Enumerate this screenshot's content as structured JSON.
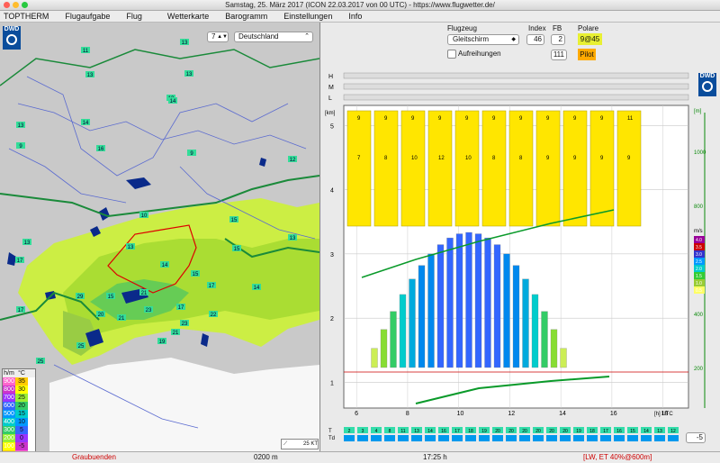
{
  "window": {
    "title": "Samstag, 25. März 2017 (ICON 22.03.2017 von 00 UTC) - https://www.flugwetter.de/"
  },
  "menu": [
    "TOPTHERM",
    "Flugaufgabe",
    "Flug",
    "Wetterkarte",
    "Barogramm",
    "Einstellungen",
    "Info"
  ],
  "map": {
    "hour": "7",
    "region": "Deutschland",
    "logo": "DWD",
    "wind_label": "25 KT",
    "legend_headers": [
      "h/m",
      "°C"
    ],
    "legend_alt": [
      "900",
      "800",
      "700",
      "600",
      "500",
      "400",
      "300",
      "200",
      "100",
      "50"
    ],
    "legend_temp": [
      "35",
      "30",
      "25",
      "20",
      "15",
      "10",
      "5",
      "0",
      "-5",
      "-10"
    ],
    "legend_colors": [
      "#ff66cc",
      "#cc33cc",
      "#9933ff",
      "#3366ff",
      "#0099ff",
      "#00cccc",
      "#33cc66",
      "#99ee33",
      "#ffff00",
      "#ffcc00"
    ],
    "values": [
      "11",
      "13",
      "13",
      "13",
      "13",
      "13",
      "12",
      "14",
      "16",
      "14",
      "9",
      "9",
      "10",
      "13",
      "14",
      "15",
      "15",
      "13",
      "15",
      "17",
      "13",
      "14",
      "17",
      "15",
      "21",
      "29",
      "20",
      "21",
      "23",
      "19",
      "21",
      "22",
      "23",
      "25",
      "25",
      "17",
      "17"
    ]
  },
  "controls": {
    "flugzeug_label": "Flugzeug",
    "flugzeug_value": "Gleitschirm",
    "index_label": "Index",
    "index_value": "46",
    "fb_label": "FB",
    "fb_value": "2",
    "polare_label": "Polare",
    "polare_value": "9@45",
    "aufreihungen_label": "Aufreihungen",
    "pilot_value": "111",
    "pilot_label": "Pilot"
  },
  "chart_data": {
    "type": "table",
    "y_left_unit": "[km]",
    "y_left_ticks": [
      "1",
      "2",
      "3",
      "4",
      "5"
    ],
    "y_right_ticks": [
      "200",
      "400",
      "600",
      "800",
      "1000"
    ],
    "y_right_unit": "[m]",
    "x_ticks": [
      "6",
      "8",
      "10",
      "12",
      "14",
      "16",
      "18"
    ],
    "x_unit": "[h] UTC",
    "cloud_rows": [
      "H",
      "M",
      "L"
    ],
    "row_labels": [
      "T",
      "Td"
    ],
    "bottom_values": [
      "2",
      "3",
      "4",
      "8",
      "11",
      "13",
      "14",
      "16",
      "17",
      "18",
      "19",
      "20",
      "20",
      "20",
      "20",
      "20",
      "20",
      "19",
      "18",
      "17",
      "16",
      "15",
      "14",
      "13",
      "12"
    ],
    "cumulus_top_values": [
      "9",
      "9",
      "9",
      "9",
      "9",
      "9",
      "9",
      "9",
      "9",
      "9",
      "11"
    ],
    "cumulus_mid_values": [
      "7",
      "8",
      "10",
      "12",
      "10",
      "8",
      "8",
      "9",
      "9",
      "9",
      "9"
    ],
    "climb_legend": [
      "4.0",
      "3.5",
      "3.0",
      "2.5",
      "2.0",
      "1.5",
      "1.0",
      "0.5"
    ],
    "climb_unit": "m/s",
    "scale_value": "-5"
  },
  "status": {
    "left": "Graubuenden",
    "altitude": "0200 m",
    "time": "17:25 h",
    "right": "[LW, ET  40%@600m]"
  }
}
